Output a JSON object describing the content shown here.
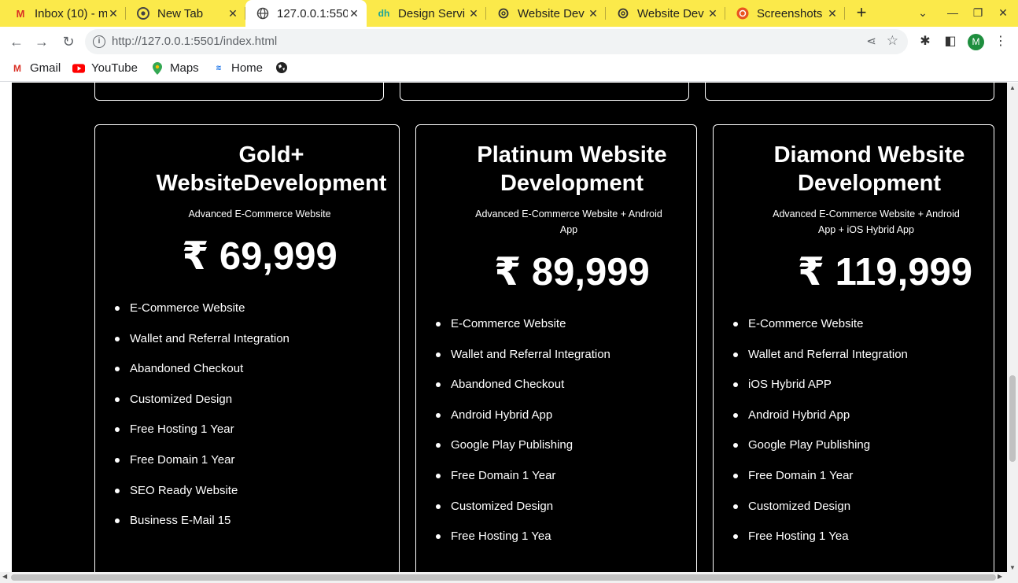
{
  "browser": {
    "tabs": [
      {
        "title": "Inbox (10) - m",
        "icon": "gmail-icon",
        "active": false
      },
      {
        "title": "New Tab",
        "icon": "chrome-icon",
        "active": false
      },
      {
        "title": "127.0.0.1:550",
        "icon": "globe-icon",
        "active": true
      },
      {
        "title": "Design Servi",
        "icon": "dh-icon",
        "active": false
      },
      {
        "title": "Website Dev",
        "icon": "openai-icon",
        "active": false
      },
      {
        "title": "Website Dev",
        "icon": "openai-icon",
        "active": false
      },
      {
        "title": "Screenshots",
        "icon": "ubuntu-icon",
        "active": false
      }
    ],
    "url_host": "http://127.0.0.1",
    "url_rest": ":5501/index.html",
    "profile_initial": "M",
    "accent_color": "#fbe94a"
  },
  "bookmarks": [
    {
      "label": "Gmail",
      "icon": "gmail-icon"
    },
    {
      "label": "YouTube",
      "icon": "youtube-icon"
    },
    {
      "label": "Maps",
      "icon": "maps-icon"
    },
    {
      "label": "Home",
      "icon": "home-icon"
    },
    {
      "label": "",
      "icon": "globe-icon"
    }
  ],
  "plans": [
    {
      "title": "Gold+ WebsiteDevelopment",
      "subtitle": "Advanced E-Commerce Website",
      "price": "₹ 69,999",
      "features": [
        "E-Commerce Website",
        "Wallet and Referral Integration",
        "Abandoned Checkout",
        "Customized Design",
        "Free Hosting 1 Year",
        "Free Domain 1 Year",
        "SEO Ready Website",
        "Business E-Mail 15"
      ]
    },
    {
      "title": "Platinum Website Development",
      "subtitle": "Advanced E-Commerce Website + Android App",
      "price": "₹ 89,999",
      "features": [
        "E-Commerce Website",
        "Wallet and Referral Integration",
        "Abandoned Checkout",
        "Android Hybrid App",
        "Google Play Publishing",
        "Free Domain 1 Year",
        "Customized Design",
        "Free Hosting 1 Yea"
      ]
    },
    {
      "title": "Diamond Website Development",
      "subtitle": "Advanced E-Commerce Website + Android App + iOS Hybrid App",
      "price": "₹ 119,999",
      "features": [
        "E-Commerce Website",
        "Wallet and Referral Integration",
        "iOS Hybrid APP",
        "Android Hybrid App",
        "Google Play Publishing",
        "Free Domain 1 Year",
        "Customized Design",
        "Free Hosting 1 Yea"
      ]
    }
  ]
}
